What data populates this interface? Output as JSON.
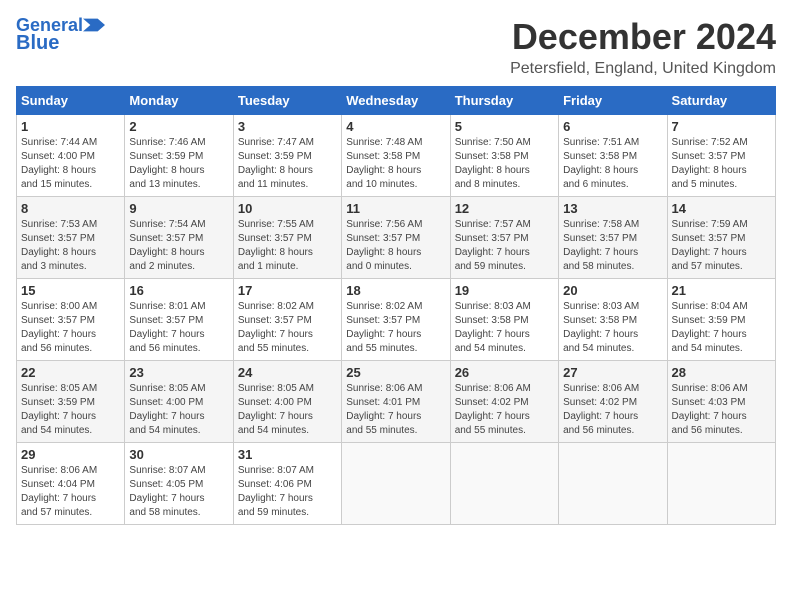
{
  "logo": {
    "line1": "General",
    "line2": "Blue"
  },
  "title": "December 2024",
  "subtitle": "Petersfield, England, United Kingdom",
  "days_of_week": [
    "Sunday",
    "Monday",
    "Tuesday",
    "Wednesday",
    "Thursday",
    "Friday",
    "Saturday"
  ],
  "weeks": [
    [
      {
        "day": "1",
        "info": "Sunrise: 7:44 AM\nSunset: 4:00 PM\nDaylight: 8 hours\nand 15 minutes."
      },
      {
        "day": "2",
        "info": "Sunrise: 7:46 AM\nSunset: 3:59 PM\nDaylight: 8 hours\nand 13 minutes."
      },
      {
        "day": "3",
        "info": "Sunrise: 7:47 AM\nSunset: 3:59 PM\nDaylight: 8 hours\nand 11 minutes."
      },
      {
        "day": "4",
        "info": "Sunrise: 7:48 AM\nSunset: 3:58 PM\nDaylight: 8 hours\nand 10 minutes."
      },
      {
        "day": "5",
        "info": "Sunrise: 7:50 AM\nSunset: 3:58 PM\nDaylight: 8 hours\nand 8 minutes."
      },
      {
        "day": "6",
        "info": "Sunrise: 7:51 AM\nSunset: 3:58 PM\nDaylight: 8 hours\nand 6 minutes."
      },
      {
        "day": "7",
        "info": "Sunrise: 7:52 AM\nSunset: 3:57 PM\nDaylight: 8 hours\nand 5 minutes."
      }
    ],
    [
      {
        "day": "8",
        "info": "Sunrise: 7:53 AM\nSunset: 3:57 PM\nDaylight: 8 hours\nand 3 minutes."
      },
      {
        "day": "9",
        "info": "Sunrise: 7:54 AM\nSunset: 3:57 PM\nDaylight: 8 hours\nand 2 minutes."
      },
      {
        "day": "10",
        "info": "Sunrise: 7:55 AM\nSunset: 3:57 PM\nDaylight: 8 hours\nand 1 minute."
      },
      {
        "day": "11",
        "info": "Sunrise: 7:56 AM\nSunset: 3:57 PM\nDaylight: 8 hours\nand 0 minutes."
      },
      {
        "day": "12",
        "info": "Sunrise: 7:57 AM\nSunset: 3:57 PM\nDaylight: 7 hours\nand 59 minutes."
      },
      {
        "day": "13",
        "info": "Sunrise: 7:58 AM\nSunset: 3:57 PM\nDaylight: 7 hours\nand 58 minutes."
      },
      {
        "day": "14",
        "info": "Sunrise: 7:59 AM\nSunset: 3:57 PM\nDaylight: 7 hours\nand 57 minutes."
      }
    ],
    [
      {
        "day": "15",
        "info": "Sunrise: 8:00 AM\nSunset: 3:57 PM\nDaylight: 7 hours\nand 56 minutes."
      },
      {
        "day": "16",
        "info": "Sunrise: 8:01 AM\nSunset: 3:57 PM\nDaylight: 7 hours\nand 56 minutes."
      },
      {
        "day": "17",
        "info": "Sunrise: 8:02 AM\nSunset: 3:57 PM\nDaylight: 7 hours\nand 55 minutes."
      },
      {
        "day": "18",
        "info": "Sunrise: 8:02 AM\nSunset: 3:57 PM\nDaylight: 7 hours\nand 55 minutes."
      },
      {
        "day": "19",
        "info": "Sunrise: 8:03 AM\nSunset: 3:58 PM\nDaylight: 7 hours\nand 54 minutes."
      },
      {
        "day": "20",
        "info": "Sunrise: 8:03 AM\nSunset: 3:58 PM\nDaylight: 7 hours\nand 54 minutes."
      },
      {
        "day": "21",
        "info": "Sunrise: 8:04 AM\nSunset: 3:59 PM\nDaylight: 7 hours\nand 54 minutes."
      }
    ],
    [
      {
        "day": "22",
        "info": "Sunrise: 8:05 AM\nSunset: 3:59 PM\nDaylight: 7 hours\nand 54 minutes."
      },
      {
        "day": "23",
        "info": "Sunrise: 8:05 AM\nSunset: 4:00 PM\nDaylight: 7 hours\nand 54 minutes."
      },
      {
        "day": "24",
        "info": "Sunrise: 8:05 AM\nSunset: 4:00 PM\nDaylight: 7 hours\nand 54 minutes."
      },
      {
        "day": "25",
        "info": "Sunrise: 8:06 AM\nSunset: 4:01 PM\nDaylight: 7 hours\nand 55 minutes."
      },
      {
        "day": "26",
        "info": "Sunrise: 8:06 AM\nSunset: 4:02 PM\nDaylight: 7 hours\nand 55 minutes."
      },
      {
        "day": "27",
        "info": "Sunrise: 8:06 AM\nSunset: 4:02 PM\nDaylight: 7 hours\nand 56 minutes."
      },
      {
        "day": "28",
        "info": "Sunrise: 8:06 AM\nSunset: 4:03 PM\nDaylight: 7 hours\nand 56 minutes."
      }
    ],
    [
      {
        "day": "29",
        "info": "Sunrise: 8:06 AM\nSunset: 4:04 PM\nDaylight: 7 hours\nand 57 minutes."
      },
      {
        "day": "30",
        "info": "Sunrise: 8:07 AM\nSunset: 4:05 PM\nDaylight: 7 hours\nand 58 minutes."
      },
      {
        "day": "31",
        "info": "Sunrise: 8:07 AM\nSunset: 4:06 PM\nDaylight: 7 hours\nand 59 minutes."
      },
      {
        "day": "",
        "info": ""
      },
      {
        "day": "",
        "info": ""
      },
      {
        "day": "",
        "info": ""
      },
      {
        "day": "",
        "info": ""
      }
    ]
  ]
}
